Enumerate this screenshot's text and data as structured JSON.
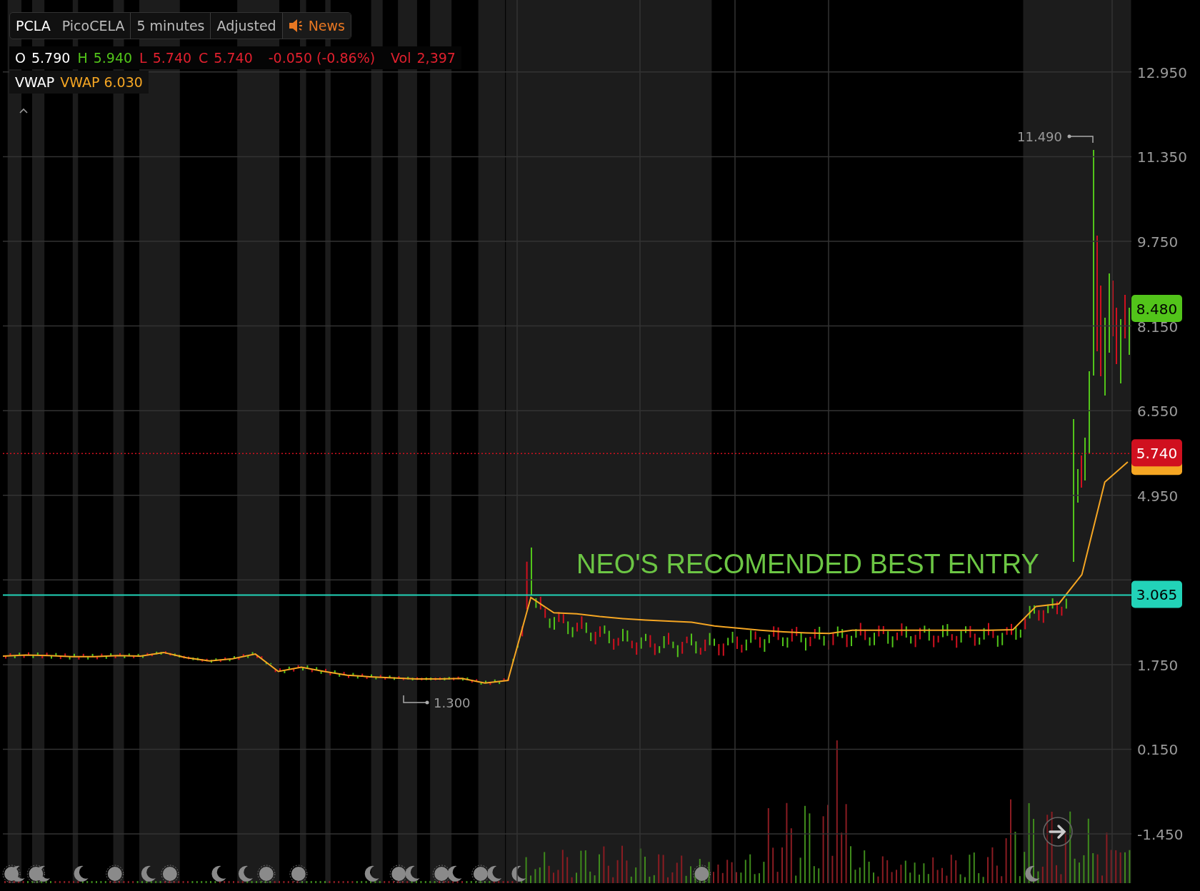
{
  "toolbar": {
    "symbol": "PCLA",
    "name": "PicoCELA",
    "interval": "5 minutes",
    "adjustment": "Adjusted",
    "news": "News"
  },
  "quote": [
    {
      "label": "O",
      "value": "5.790",
      "color": "#ffffff"
    },
    {
      "label": "H",
      "value": "5.940",
      "color": "#52c41a"
    },
    {
      "label": "L",
      "value": "5.740",
      "color": "#e0202e"
    },
    {
      "label": "C",
      "value": "5.740",
      "color": "#e0202e"
    },
    {
      "value": "-0.050 (-0.86%)",
      "color": "#e0202e"
    },
    {
      "label": "Vol",
      "value": "2,397",
      "color": "#e0202e"
    }
  ],
  "study_value": "VWAP 6.030",
  "chart_data": {
    "type": "line",
    "ylim": [
      -2.38,
      14.31
    ],
    "grid": true,
    "yticks": [
      {
        "value": 12.95,
        "label": "12.950"
      },
      {
        "value": 11.35,
        "label": "11.350"
      },
      {
        "value": 9.75,
        "label": "9.750"
      },
      {
        "value": 8.15,
        "label": "8.150"
      },
      {
        "value": 6.55,
        "label": "6.550"
      },
      {
        "value": 4.95,
        "label": "4.950"
      },
      {
        "value": 1.75,
        "label": "1.750"
      },
      {
        "value": 0.15,
        "label": "0.150"
      },
      {
        "value": -1.45,
        "label": "-1.450"
      }
    ],
    "series": [
      {
        "name": "VWAP",
        "color": "#f5a623",
        "values": [
          1.91,
          1.93,
          1.92,
          1.9,
          1.9,
          1.92,
          1.91,
          1.98,
          1.88,
          1.82,
          1.86,
          1.95,
          1.62,
          1.7,
          1.62,
          1.55,
          1.52,
          1.5,
          1.48,
          1.48,
          1.49,
          1.4,
          1.45,
          3.02,
          2.73,
          2.71,
          2.66,
          2.62,
          2.59,
          2.57,
          2.55,
          2.48,
          2.44,
          2.4,
          2.37,
          2.35,
          2.34,
          2.4,
          2.4,
          2.4,
          2.4,
          2.4,
          2.4,
          2.4,
          2.41,
          2.85,
          2.9,
          3.45,
          5.2,
          5.58
        ]
      }
    ],
    "ref_lines": [
      {
        "axis": "y",
        "value": 3.065,
        "label": "3.065",
        "color": "#22d3b8"
      },
      {
        "axis": "y",
        "value": 5.74,
        "label": "5.740",
        "color": "#d0101f"
      }
    ],
    "annotations": [
      "11.490",
      "1.300",
      "NEO'S RECOMENDED BEST ENTRY",
      "8.480"
    ]
  }
}
